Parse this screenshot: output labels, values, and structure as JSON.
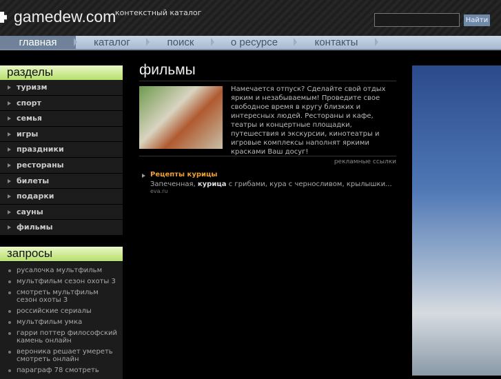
{
  "header": {
    "logo": "gamedew.com",
    "tagline": "контекстный каталог",
    "search_placeholder": "",
    "search_button": "Найти"
  },
  "nav": [
    "главная",
    "каталог",
    "поиск",
    "о ресурсе",
    "контакты"
  ],
  "sections": {
    "title": "разделы",
    "items": [
      "туризм",
      "спорт",
      "семья",
      "игры",
      "праздники",
      "рестораны",
      "билеты",
      "подарки",
      "сауны",
      "фильмы"
    ]
  },
  "queries": {
    "title": "запросы",
    "items": [
      "русалочка мультфильм",
      "мультфильм сезон охоты 3",
      "смотреть мультфильм сезон охоты 3",
      "российские сериалы",
      "мультфильм умка",
      "гарри поттер философский камень онлайн",
      "вероника решает умереть смотреть онлайн",
      "параграф 78 смотреть"
    ]
  },
  "main": {
    "title": "фильмы",
    "intro": "Намечается отпуск? Сделайте свой отдых ярким и незабываемым! Проведите свое свободное время в кругу близких и интересных людей. Рестораны и кафе, театры и концертные площадки, путешествия и экскурсии, кинотеатры и игровые комплексы наполнят яркими красками Ваш досуг!",
    "ads_label": "рекламные ссылки",
    "ad": {
      "title": "Рецепты курицы",
      "text_before": "Запеченная, ",
      "text_bold": "курица",
      "text_after": " с грибами, кура с черносливом, крылышки...",
      "url": "eva.ru"
    }
  }
}
